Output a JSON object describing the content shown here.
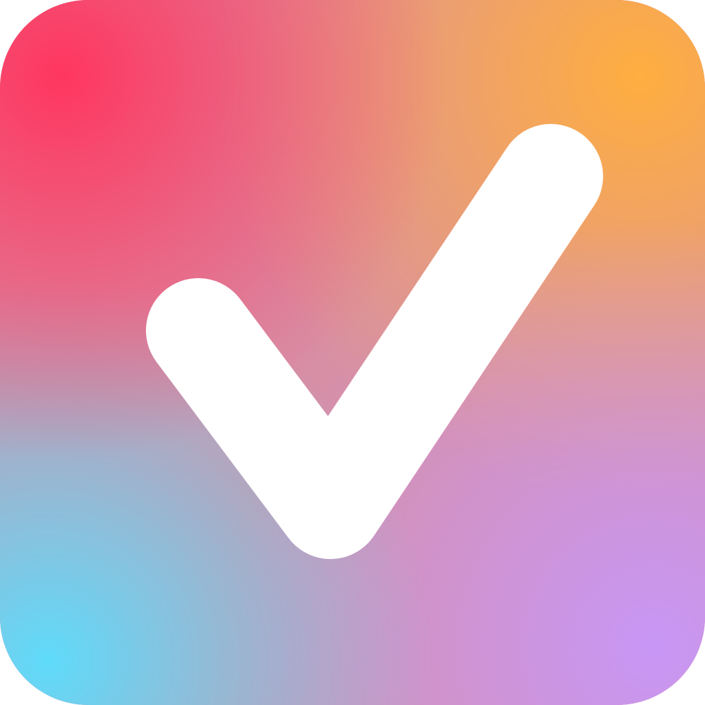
{
  "app_icon": {
    "name": "checkmark-app-icon",
    "icon": "checkmark-icon",
    "colors": {
      "top_left": "#ff365f",
      "top_right": "#ffae3f",
      "bottom_left": "#5fdbfa",
      "bottom_right": "#c897f6",
      "center": "#d78fa6",
      "glyph": "#ffffff"
    }
  }
}
